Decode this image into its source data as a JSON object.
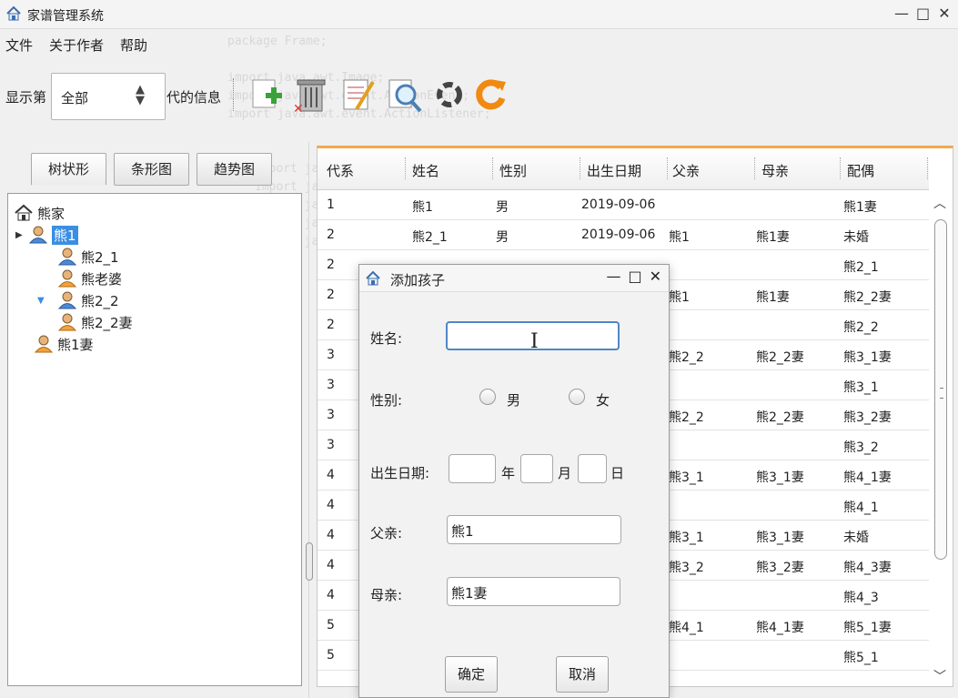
{
  "window": {
    "title": "家谱管理系统",
    "minimize": "—",
    "maximize": "□",
    "close": "✕"
  },
  "menu": [
    "文件",
    "关于作者",
    "帮助"
  ],
  "toolbar": {
    "label_prefix": "显示第",
    "select_value": "全部",
    "label_suffix": "代的信息",
    "icons": [
      "add-icon",
      "delete-icon",
      "edit-icon",
      "search-icon",
      "refresh-icon",
      "reload-icon"
    ]
  },
  "tabs": [
    "树状形",
    "条形图",
    "趋势图"
  ],
  "tree": [
    {
      "label": "熊家",
      "type": "home"
    },
    {
      "label": "熊1",
      "type": "male",
      "selected": true
    },
    {
      "label": "熊2_1",
      "type": "male"
    },
    {
      "label": "熊老婆",
      "type": "female"
    },
    {
      "label": "熊2_2",
      "type": "male"
    },
    {
      "label": "熊2_2妻",
      "type": "female"
    },
    {
      "label": "熊1妻",
      "type": "female"
    }
  ],
  "table": {
    "headers": [
      "代系",
      "姓名",
      "性别",
      "出生日期",
      "父亲",
      "母亲",
      "配偶"
    ],
    "rows": [
      [
        "1",
        "熊1",
        "男",
        "2019-09-06",
        "",
        "",
        "熊1妻"
      ],
      [
        "2",
        "熊2_1",
        "男",
        "2019-09-06",
        "熊1",
        "熊1妻",
        "未婚"
      ],
      [
        "2",
        "",
        "",
        "",
        "",
        "",
        "熊2_1"
      ],
      [
        "2",
        "",
        "",
        "",
        "熊1",
        "熊1妻",
        "熊2_2妻"
      ],
      [
        "2",
        "",
        "",
        "",
        "",
        "",
        "熊2_2"
      ],
      [
        "3",
        "",
        "",
        "",
        "熊2_2",
        "熊2_2妻",
        "熊3_1妻"
      ],
      [
        "3",
        "",
        "",
        "",
        "",
        "",
        "熊3_1"
      ],
      [
        "3",
        "",
        "",
        "",
        "熊2_2",
        "熊2_2妻",
        "熊3_2妻"
      ],
      [
        "3",
        "",
        "",
        "",
        "",
        "",
        "熊3_2"
      ],
      [
        "4",
        "",
        "",
        "",
        "熊3_1",
        "熊3_1妻",
        "熊4_1妻"
      ],
      [
        "4",
        "",
        "",
        "",
        "",
        "",
        "熊4_1"
      ],
      [
        "4",
        "",
        "",
        "",
        "熊3_1",
        "熊3_1妻",
        "未婚"
      ],
      [
        "4",
        "",
        "",
        "",
        "熊3_2",
        "熊3_2妻",
        "熊4_3妻"
      ],
      [
        "4",
        "",
        "",
        "",
        "",
        "",
        "熊4_3"
      ],
      [
        "5",
        "",
        "",
        "",
        "熊4_1",
        "熊4_1妻",
        "熊5_1妻"
      ],
      [
        "5",
        "",
        "",
        "",
        "",
        "",
        "熊5_1"
      ]
    ]
  },
  "dialog": {
    "title": "添加孩子",
    "name_label": "姓名:",
    "name_value": "",
    "gender_label": "性别:",
    "male": "男",
    "female": "女",
    "birth_label": "出生日期:",
    "year": "年",
    "month": "月",
    "day": "日",
    "father_label": "父亲:",
    "father_value": "熊1",
    "mother_label": "母亲:",
    "mother_value": "熊1妻",
    "ok": "确定",
    "cancel": "取消"
  },
  "colors": {
    "selection": "#3b8ee3",
    "table_accent": "#f2a94b",
    "focus_border": "#4f86c6"
  }
}
